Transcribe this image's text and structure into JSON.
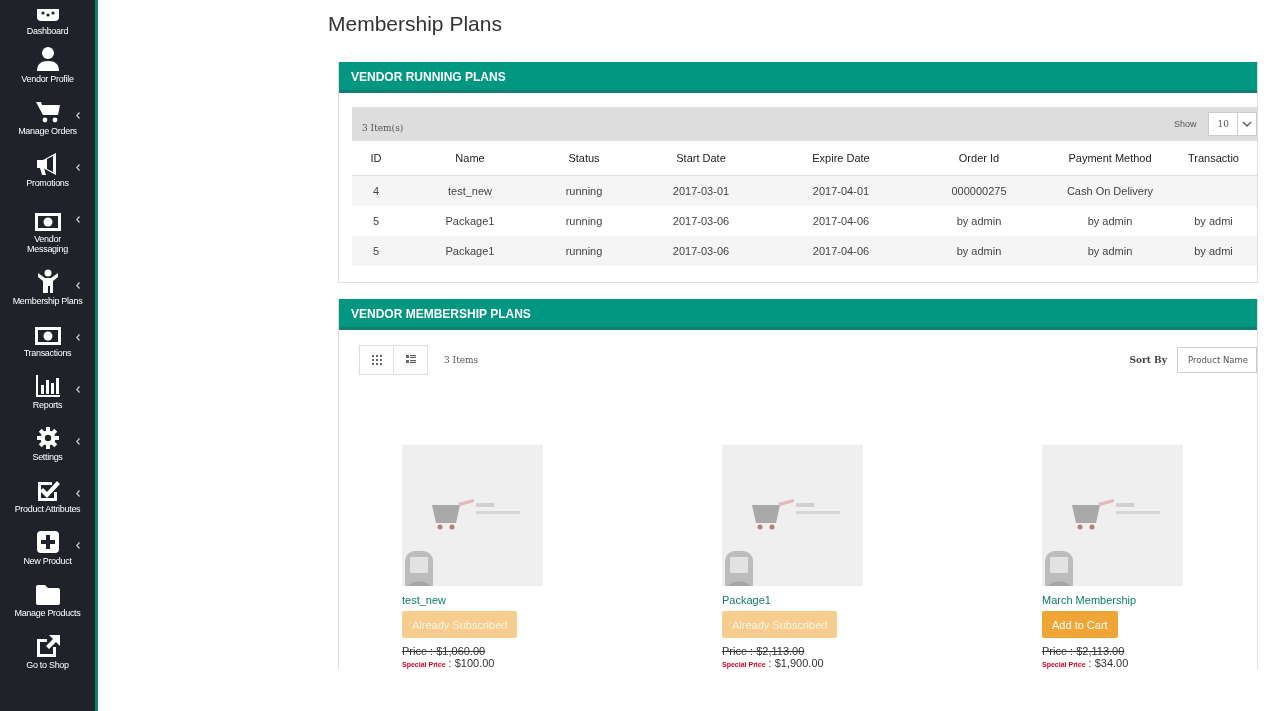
{
  "sidebar": {
    "items": [
      {
        "label": "Dashboard",
        "expandable": false
      },
      {
        "label": "Vendor Profile",
        "expandable": false
      },
      {
        "label": "Manage Orders",
        "expandable": true
      },
      {
        "label": "Promotions",
        "expandable": true
      },
      {
        "label": "Vendor Messaging",
        "expandable": true
      },
      {
        "label": "Membership Plans",
        "expandable": true
      },
      {
        "label": "Transactions",
        "expandable": true
      },
      {
        "label": "Reports",
        "expandable": true
      },
      {
        "label": "Settings",
        "expandable": true
      },
      {
        "label": "Product Attributes",
        "expandable": true
      },
      {
        "label": "New Product",
        "expandable": true
      },
      {
        "label": "Manage Products",
        "expandable": false
      },
      {
        "label": "Go to Shop",
        "expandable": false
      }
    ]
  },
  "page_title": "Membership Plans",
  "running_plans": {
    "title": "VENDOR RUNNING PLANS",
    "item_count": "3 Item(s)",
    "show_label": "Show",
    "show_value": "10",
    "columns": [
      "ID",
      "Name",
      "Status",
      "Start Date",
      "Expire Date",
      "Order Id",
      "Payment Method",
      "Transactio"
    ],
    "rows": [
      [
        "4",
        "test_new",
        "running",
        "2017-03-01",
        "2017-04-01",
        "000000275",
        "Cash On Delivery",
        ""
      ],
      [
        "5",
        "Package1",
        "running",
        "2017-03-06",
        "2017-04-06",
        "by admin",
        "by admin",
        "by admi"
      ],
      [
        "5",
        "Package1",
        "running",
        "2017-03-06",
        "2017-04-06",
        "by admin",
        "by admin",
        "by admi"
      ]
    ]
  },
  "membership_plans": {
    "title": "VENDOR MEMBERSHIP PLANS",
    "item_count": "3 Items",
    "sort_label": "Sort By",
    "sort_value": "Product Name",
    "plans": [
      {
        "name": "test_new",
        "button": "Already Subscribed",
        "disabled": true,
        "price": "Price : $1,060.00",
        "special_label": "Special Price",
        "special_price": ": $100.00"
      },
      {
        "name": "Package1",
        "button": "Already Subscribed",
        "disabled": true,
        "price": "Price : $2,113.00",
        "special_label": "Special Price",
        "special_price": ": $1,900.00"
      },
      {
        "name": "March Membership",
        "button": "Add to Cart",
        "disabled": false,
        "price": "Price : $2,113.00",
        "special_label": "Special Price",
        "special_price": ": $34.00"
      }
    ]
  }
}
